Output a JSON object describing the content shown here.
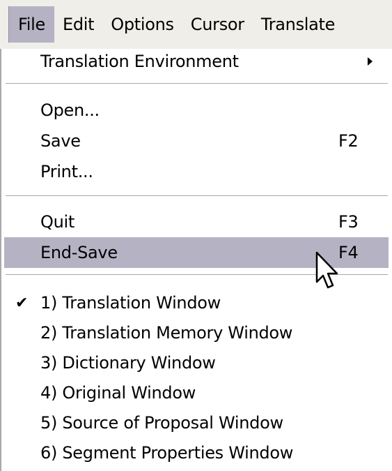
{
  "menubar": {
    "items": [
      {
        "label": "File"
      },
      {
        "label": "Edit"
      },
      {
        "label": "Options"
      },
      {
        "label": "Cursor"
      },
      {
        "label": "Translate"
      }
    ]
  },
  "file_menu": {
    "translation_environment": {
      "label": "Translation Environment"
    },
    "open": {
      "label": "Open..."
    },
    "save": {
      "label": "Save",
      "accel": "F2"
    },
    "print": {
      "label": "Print..."
    },
    "quit": {
      "label": "Quit",
      "accel": "F3"
    },
    "end_save": {
      "label": "End-Save",
      "accel": "F4"
    },
    "windows": [
      {
        "label": "1) Translation Window",
        "checked": true
      },
      {
        "label": "2) Translation Memory Window",
        "checked": false
      },
      {
        "label": "3) Dictionary Window",
        "checked": false
      },
      {
        "label": "4) Original Window",
        "checked": false
      },
      {
        "label": "5) Source of Proposal Window",
        "checked": false
      },
      {
        "label": "6) Segment Properties Window",
        "checked": false
      }
    ],
    "check_glyph": "✔"
  },
  "colors": {
    "highlight": "#b5b3c3",
    "menubar_bg": "#efeee9"
  },
  "icons": {
    "submenu": "submenu-arrow-icon",
    "pointer": "mouse-pointer-icon",
    "check": "checkmark-icon"
  }
}
